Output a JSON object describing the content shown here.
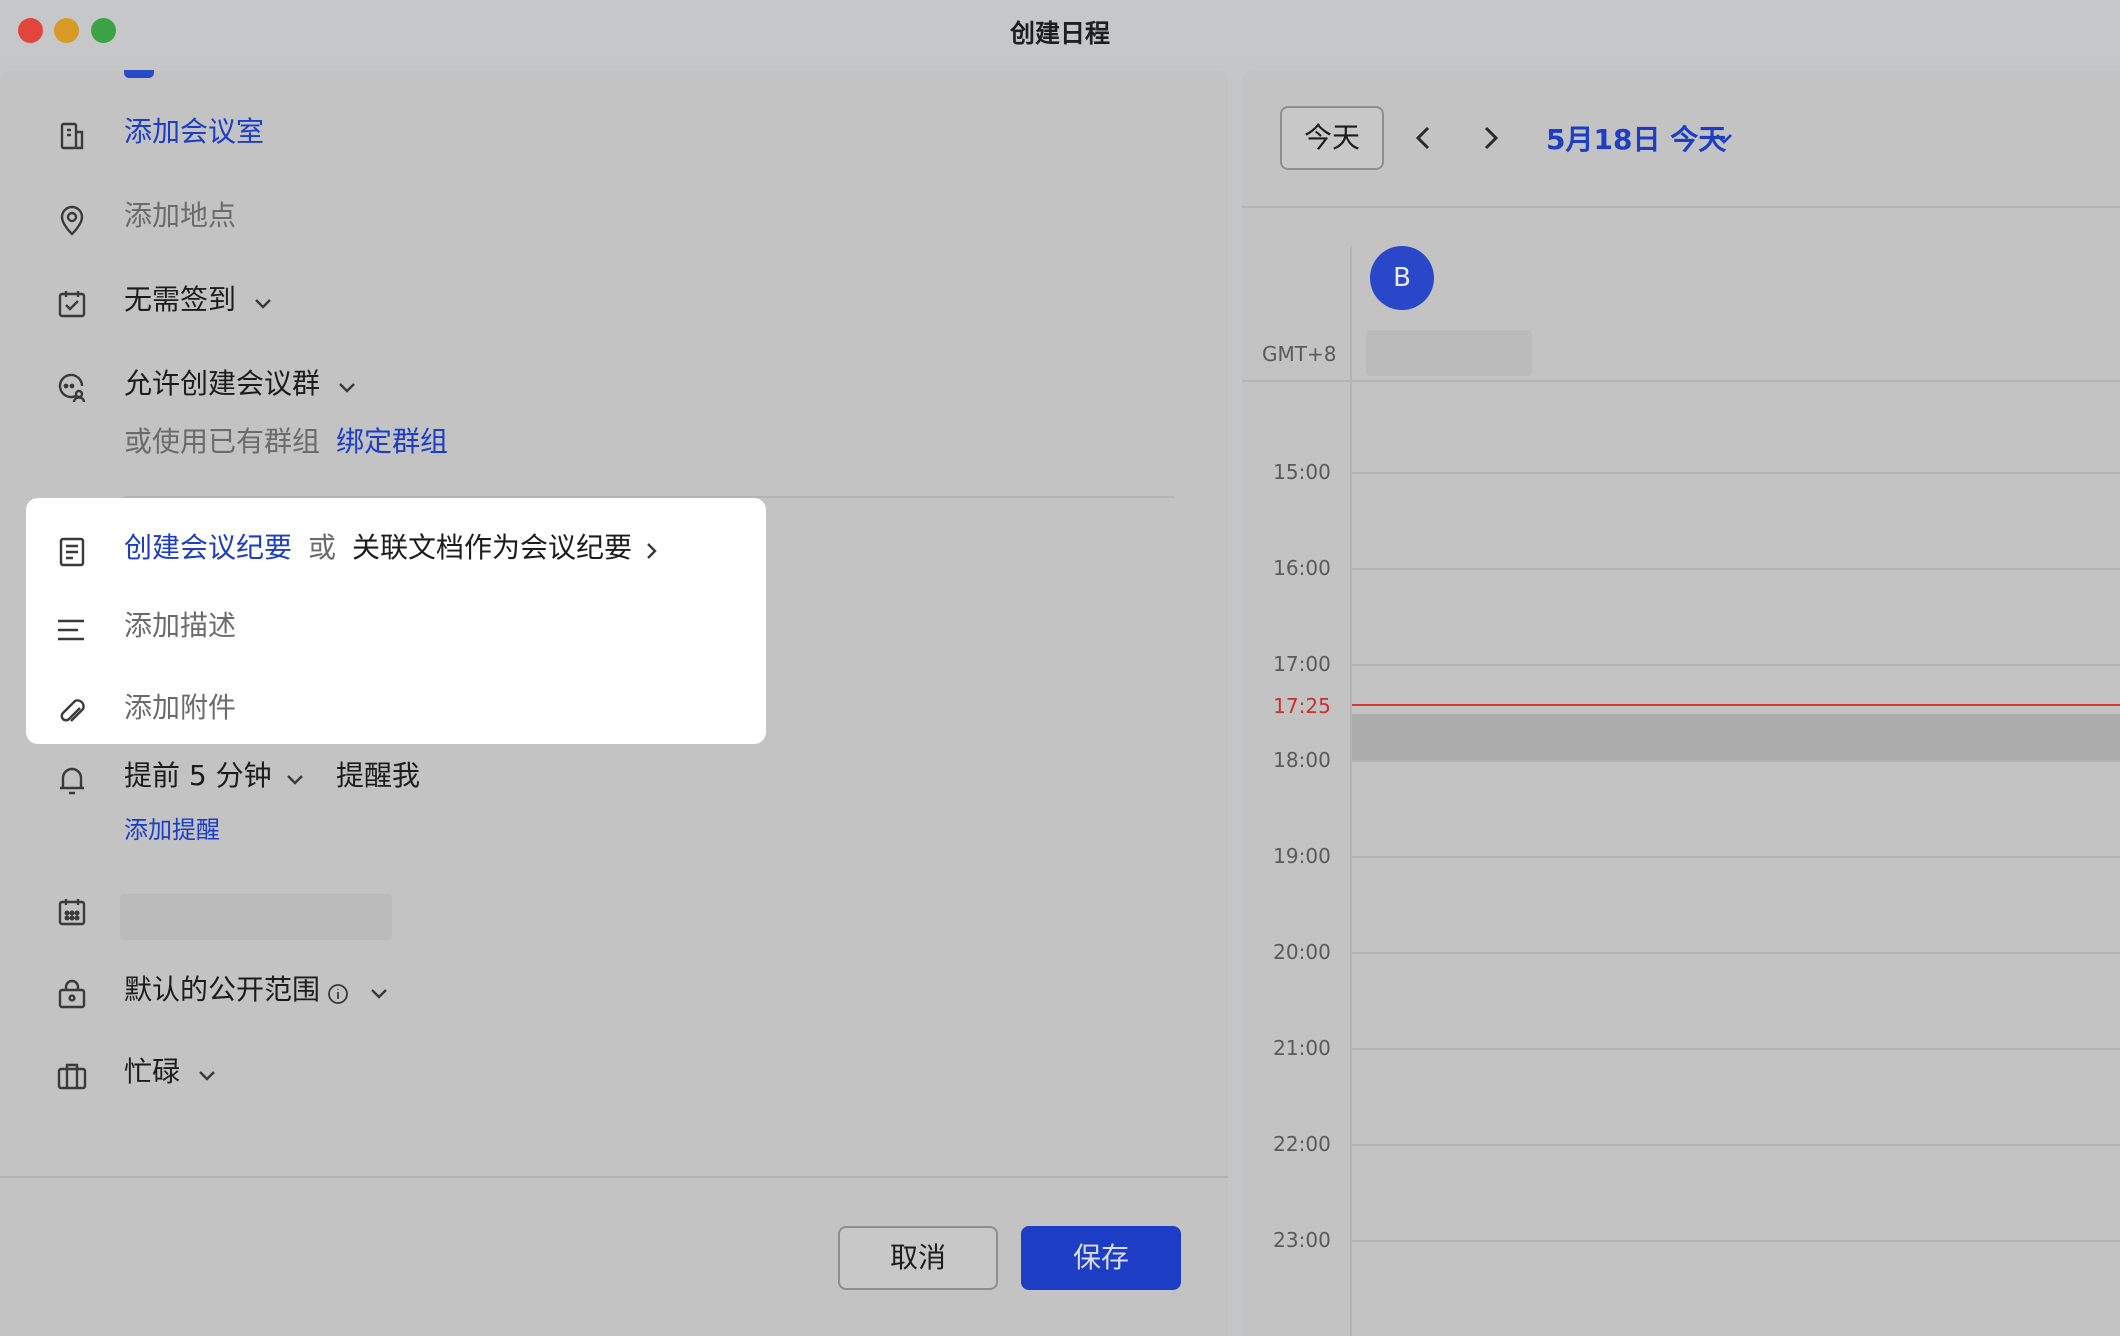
{
  "window": {
    "title": "创建日程"
  },
  "form": {
    "add_room": "添加会议室",
    "add_location": "添加地点",
    "checkin": "无需签到",
    "meeting_group": "允许创建会议群",
    "group_hint": "或使用已有群组",
    "bind_group": "绑定群组",
    "create_notes": "创建会议纪要",
    "or": "或",
    "link_doc": "关联文档作为会议纪要",
    "add_description": "添加描述",
    "add_attachment": "添加附件",
    "reminder": "提前 5 分钟",
    "remind_me": "提醒我",
    "add_reminder": "添加提醒",
    "visibility": "默认的公开范围",
    "busy": "忙碌"
  },
  "footer": {
    "cancel": "取消",
    "save": "保存"
  },
  "calendar": {
    "today": "今天",
    "date": "5月18日 今天",
    "avatar_initial": "B",
    "timezone": "GMT+8",
    "hours": [
      "15:00",
      "16:00",
      "17:00",
      "18:00",
      "19:00",
      "20:00",
      "21:00",
      "22:00",
      "23:00"
    ],
    "now": "17:25"
  },
  "colors": {
    "accent": "#1d3dc4",
    "now_line": "#d23b33",
    "highlight": "#ffffff"
  }
}
